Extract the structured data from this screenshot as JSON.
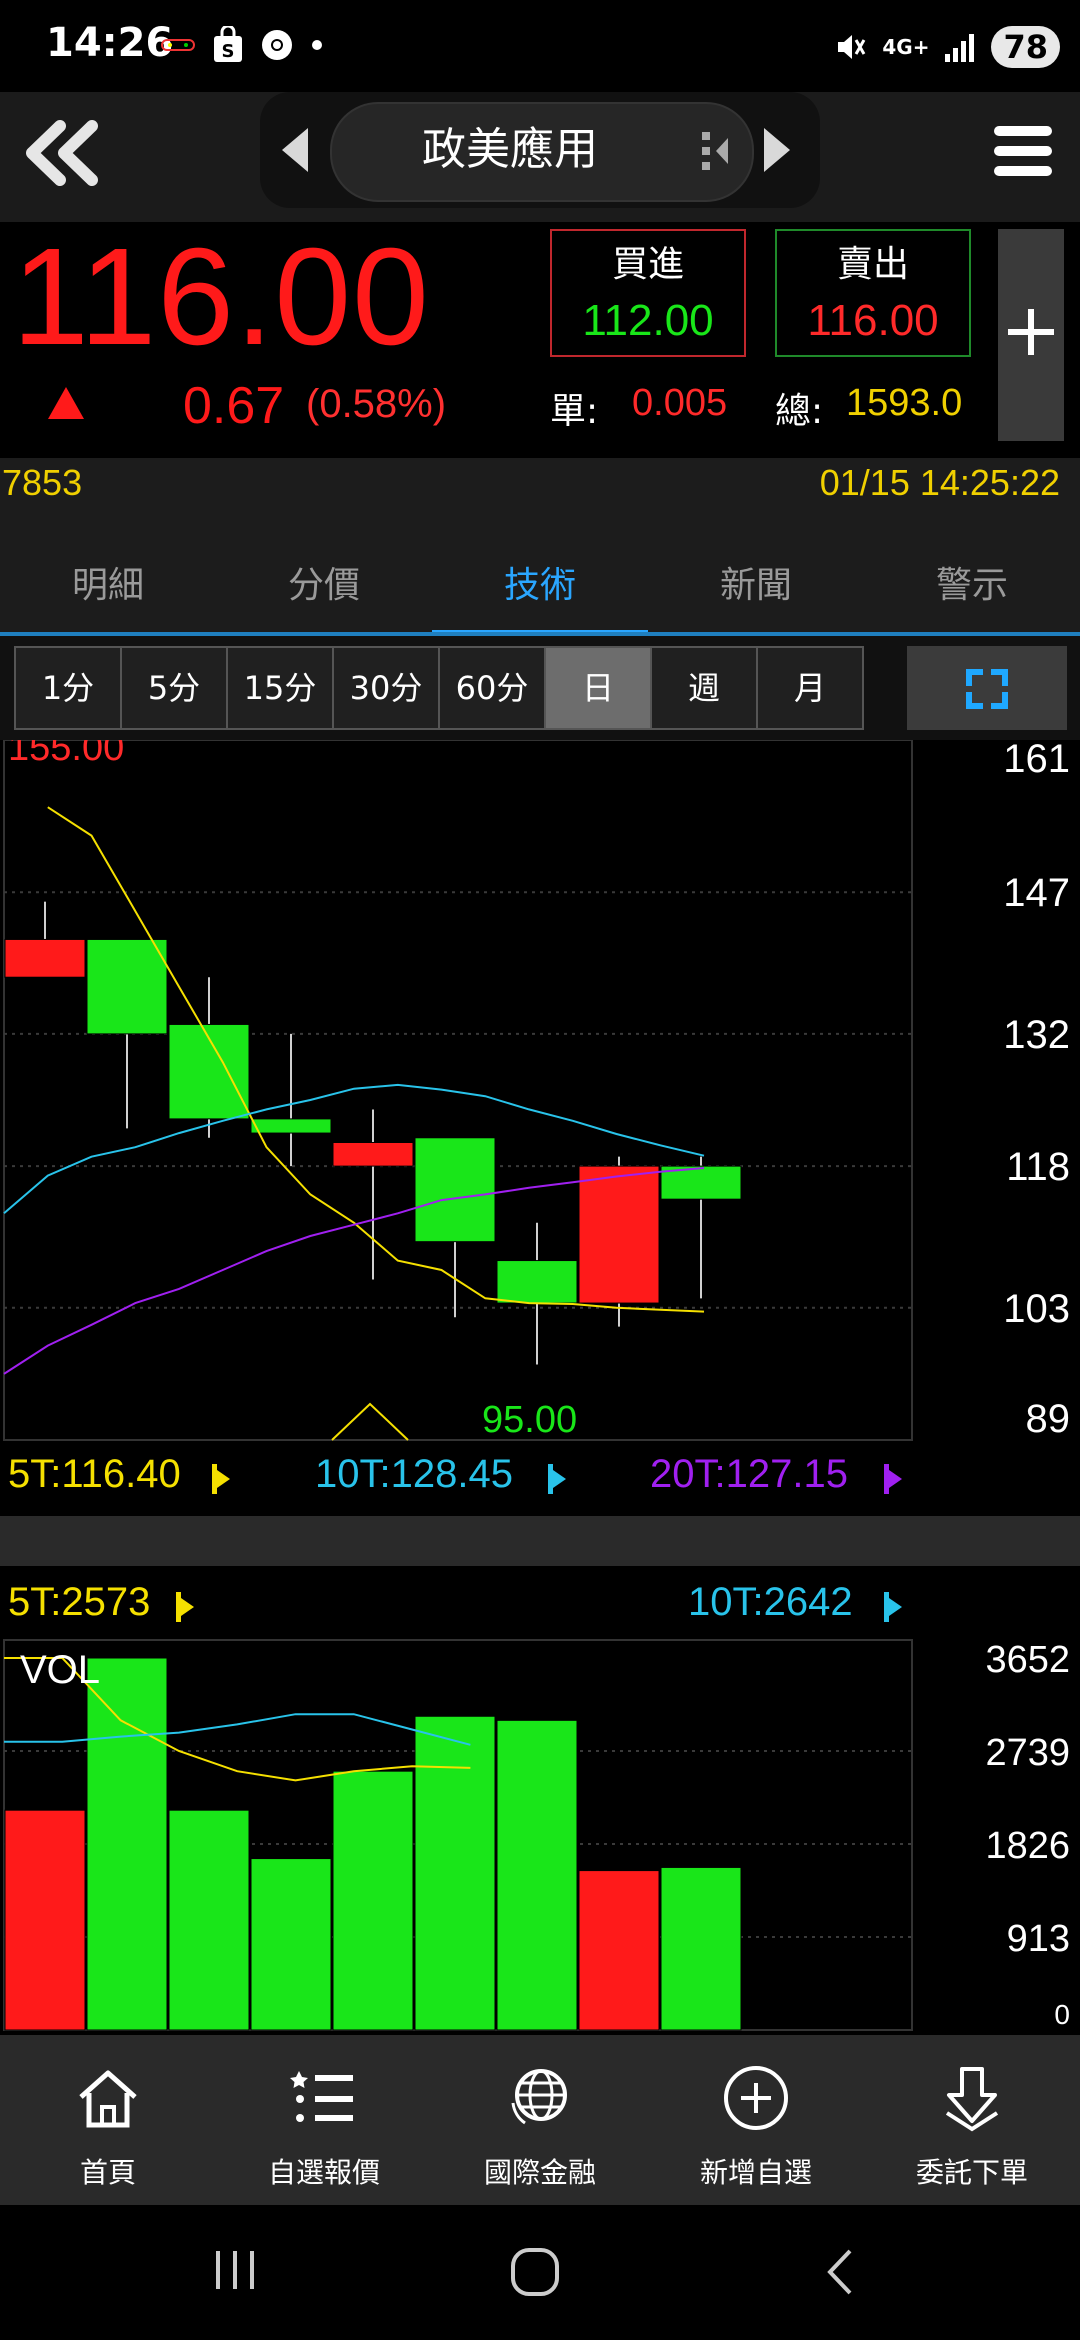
{
  "status_bar": {
    "time": "14:26",
    "network": "4G+",
    "battery": "78",
    "icons": [
      "game-icon",
      "shopping-bag-icon",
      "chrome-icon",
      "dot-icon",
      "mute-icon",
      "network-icon",
      "signal-icon",
      "battery-icon"
    ]
  },
  "header": {
    "title": "政美應用",
    "back_icon": "double-chevron-left-icon",
    "menu_icon": "hamburger-menu-icon"
  },
  "quote": {
    "price": "116.00",
    "change": "0.67",
    "change_pct": "(0.58%)",
    "buy_label": "買進",
    "buy_price": "112.00",
    "sell_label": "賣出",
    "sell_price": "116.00",
    "unit_label": "單:",
    "unit_value": "0.005",
    "total_label": "總:",
    "total_value": "1593.0",
    "add_symbol": "+"
  },
  "info": {
    "code": "7853",
    "datetime": "01/15 14:25:22"
  },
  "tabs": [
    "明細",
    "分價",
    "技術",
    "新聞",
    "警示"
  ],
  "active_tab": "技術",
  "periods": [
    "1分",
    "5分",
    "15分",
    "30分",
    "60分",
    "日",
    "週",
    "月"
  ],
  "selected_period": "日",
  "chart_data": [
    {
      "type": "candlestick",
      "y_ticks": [
        "161",
        "147",
        "132",
        "118",
        "103",
        "89"
      ],
      "ylim": [
        89,
        161
      ],
      "high_label": "155.00",
      "low_label": "95.00",
      "candles": [
        {
          "open": 142,
          "close": 138,
          "high": 146,
          "low": 138,
          "color": "red"
        },
        {
          "open": 142,
          "close": 132,
          "high": 142,
          "low": 122,
          "color": "green"
        },
        {
          "open": 133,
          "close": 123,
          "high": 138,
          "low": 121,
          "color": "green"
        },
        {
          "open": 123,
          "close": 121.5,
          "high": 132,
          "low": 118,
          "color": "green"
        },
        {
          "open": 118,
          "close": 120.5,
          "high": 124,
          "low": 106,
          "color": "red"
        },
        {
          "open": 121,
          "close": 110,
          "high": 121,
          "low": 102,
          "color": "green"
        },
        {
          "open": 108,
          "close": 103.5,
          "high": 112,
          "low": 97,
          "color": "green"
        },
        {
          "open": 103.5,
          "close": 118,
          "high": 119,
          "low": 101,
          "color": "red"
        },
        {
          "open": 118,
          "close": 114.5,
          "high": 119,
          "low": 104,
          "color": "green"
        }
      ],
      "series": [
        {
          "name": "5T",
          "label": "5T:116.40",
          "color": "#f5e000",
          "values": [
            null,
            156,
            153,
            145,
            137,
            129,
            120,
            115,
            112,
            108,
            107,
            104,
            103.5,
            103.4,
            103,
            102.8,
            102.6
          ]
        },
        {
          "name": "10T",
          "label": "10T:128.45",
          "color": "#29c3ea",
          "values": [
            113,
            117,
            119,
            120,
            121.5,
            122.8,
            124,
            125,
            126.2,
            126.6,
            126.1,
            125.4,
            124,
            122.8,
            121.4,
            120.2,
            119.1
          ]
        },
        {
          "name": "20T",
          "label": "20T:127.15",
          "color": "#a020f0",
          "values": [
            96,
            99,
            101.2,
            103.5,
            105,
            107,
            109,
            110.6,
            111.8,
            113,
            114.4,
            115,
            115.7,
            116.3,
            116.9,
            117.4,
            117.8
          ]
        }
      ],
      "ma_x_steps": 17,
      "footnote_marker": "^"
    },
    {
      "type": "bar",
      "name": "VOL",
      "y_ticks": [
        "3652",
        "2739",
        "1826",
        "913",
        "0"
      ],
      "ylim": [
        0,
        3652
      ],
      "values": [
        2158,
        3652,
        2158,
        1683,
        2541,
        3080,
        3040,
        1565,
        1596
      ],
      "colors": [
        "red",
        "green",
        "green",
        "green",
        "green",
        "green",
        "green",
        "red",
        "green"
      ],
      "series": [
        {
          "name": "5T",
          "label": "5T:2573",
          "color": "#f5e000",
          "values": [
            3652,
            3652,
            3040,
            2739,
            2541,
            2450,
            2540,
            2590,
            2573
          ]
        },
        {
          "name": "10T",
          "label": "10T:2642",
          "color": "#29c3ea",
          "values": [
            2830,
            2830,
            2880,
            2920,
            3000,
            3100,
            3100,
            2950,
            2800
          ]
        }
      ]
    }
  ],
  "colors": {
    "up": "#ff1a1a",
    "down": "#19e619",
    "accent": "#2aa6ff",
    "yellow": "#f0d000"
  },
  "bottom_nav": [
    {
      "label": "首頁",
      "icon": "home-icon"
    },
    {
      "label": "自選報價",
      "icon": "list-icon"
    },
    {
      "label": "國際金融",
      "icon": "globe-icon"
    },
    {
      "label": "新增自選",
      "icon": "add-circle-icon"
    },
    {
      "label": "委託下單",
      "icon": "download-order-icon"
    }
  ],
  "system_nav": [
    "recent-apps-icon",
    "home-circle-icon",
    "back-icon"
  ]
}
